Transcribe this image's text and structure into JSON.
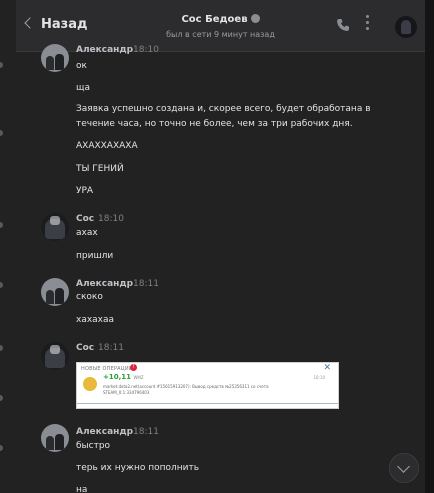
{
  "header": {
    "back_label": "Назад",
    "contact_name": "Сос Бедоев",
    "status": "был в сети 9 минут назад"
  },
  "messages": [
    {
      "author": "Александр",
      "time": "18:10",
      "lines": [
        "ок",
        "ща",
        "Заявка успешно создана и, скорее всего, будет обработана в",
        "течение часа, но точно не более, чем за три рабочих дня.",
        "АХАХХАХАХА",
        "ТЫ ГЕНИЙ",
        "УРА"
      ]
    },
    {
      "author": "Сос",
      "time": "18:10",
      "lines": [
        "ахах",
        "пришли"
      ]
    },
    {
      "author": "Александр",
      "time": "18:11",
      "lines": [
        "скоко",
        "хахахаа"
      ]
    },
    {
      "author": "Сос",
      "time": "18:11",
      "lines": []
    },
    {
      "author": "Александр",
      "time": "18:11",
      "lines": [
        "быстро",
        "терь их нужно пополнить",
        "на"
      ]
    }
  ],
  "notification": {
    "title": "НОВЫЕ ОПЕРАЦИИ",
    "badge": "!",
    "amount": "+10,11",
    "currency": "WMZ",
    "time": "18:10",
    "description": "market.dota2.net(account #15615913207): Вывод средств №25356311 со счета STEAM_0:1:334796403"
  },
  "colors": {
    "background": "#19191a",
    "panel": "#222223",
    "header": "#2c2c2e",
    "text": "#e1e3e6",
    "muted": "#7e8084",
    "amount_green": "#2a9d3a"
  }
}
